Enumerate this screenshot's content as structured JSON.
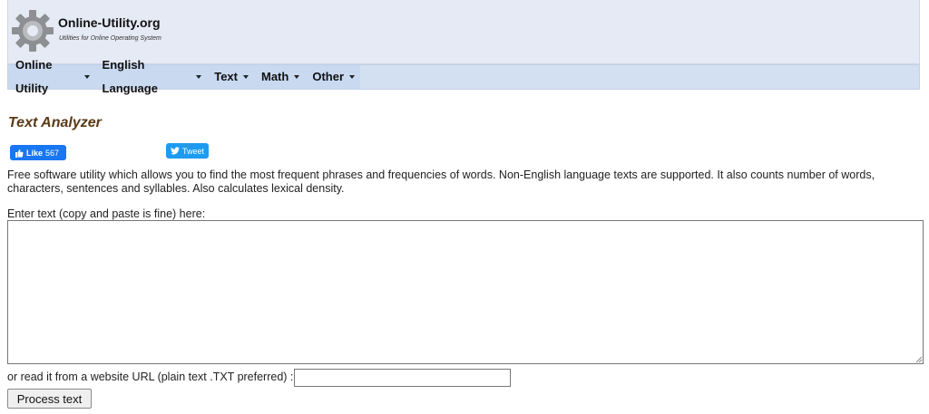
{
  "header": {
    "site_title": "Online-Utility.org",
    "site_subtitle": "Utilities for Online Operating System",
    "logo_icon": "gear-icon"
  },
  "nav": {
    "items": [
      {
        "label": "Online Utility"
      },
      {
        "label": "English Language"
      },
      {
        "label": "Text"
      },
      {
        "label": "Math"
      },
      {
        "label": "Other"
      }
    ]
  },
  "main": {
    "title": "Text Analyzer",
    "social": {
      "like_label": "Like",
      "like_count": "567",
      "tweet_label": "Tweet"
    },
    "description": "Free software utility which allows you to find the most frequent phrases and frequencies of words. Non-English language texts are supported. It also counts number of words, characters, sentences and syllables. Also calculates lexical density.",
    "enter_label": "Enter text (copy and paste is fine) here:",
    "textarea_value": "",
    "url_label": "or read it from a website URL (plain text .TXT preferred) :",
    "url_value": "",
    "process_button": "Process text"
  },
  "colors": {
    "header_bg": "#e6eaf4",
    "nav_bg": "#c8d9f0",
    "title_color": "#5a3a16",
    "facebook_blue": "#1877f2",
    "twitter_blue": "#1d9bf0"
  }
}
